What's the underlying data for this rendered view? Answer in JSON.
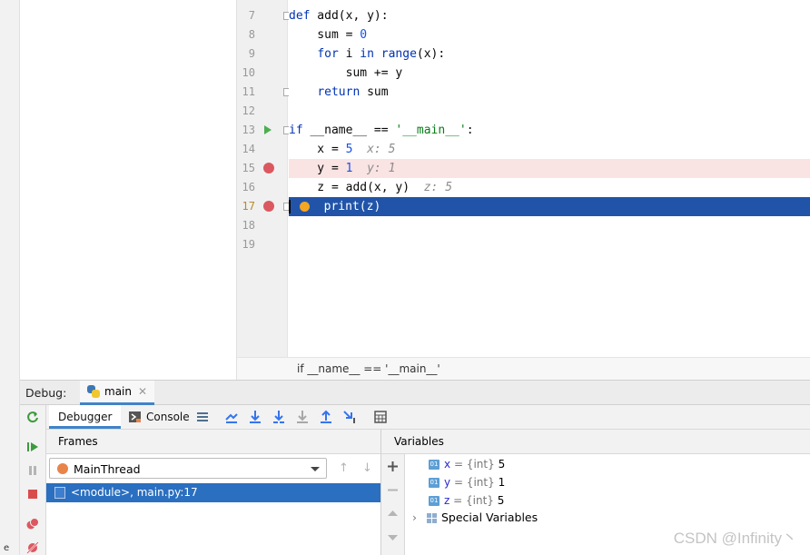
{
  "editor": {
    "lines": [
      {
        "num": "7"
      },
      {
        "num": "8"
      },
      {
        "num": "9"
      },
      {
        "num": "10"
      },
      {
        "num": "11"
      },
      {
        "num": "12"
      },
      {
        "num": "13"
      },
      {
        "num": "14"
      },
      {
        "num": "15"
      },
      {
        "num": "16"
      },
      {
        "num": "17"
      },
      {
        "num": "18"
      },
      {
        "num": "19"
      }
    ],
    "code": {
      "l7_kw": "def",
      "l7_rest": " add(x, y):",
      "l8_a": "    sum = ",
      "l8_num": "0",
      "l9_kw1": "for",
      "l9_a": " i ",
      "l9_kw2": "in",
      "l9_kw3": "range",
      "l9_rest": "(x):",
      "l10": "        sum += y",
      "l11_kw": "return",
      "l11_rest": " sum",
      "l13_kw": "if",
      "l13_a": " __name__ == ",
      "l13_str": "'__main__'",
      "l13_rest": ":",
      "l14_a": "    x = ",
      "l14_num": "5",
      "l14_hint": "x: 5",
      "l15_a": "    y = ",
      "l15_num": "1",
      "l15_hint": "y: 1",
      "l16_a": "    z = add(x, y)",
      "l16_hint": "z: 5",
      "l17": "print(z)"
    },
    "breadcrumb": "if __name__ == '__main__'"
  },
  "debug": {
    "label": "Debug:",
    "tab": "main",
    "tabs": {
      "debugger": "Debugger",
      "console": "Console"
    },
    "frames": {
      "title": "Frames",
      "thread": "MainThread",
      "selected_frame": "<module>, main.py:17"
    },
    "variables": {
      "title": "Variables",
      "items": [
        {
          "name": "x",
          "type": "= {int}",
          "value": "5"
        },
        {
          "name": "y",
          "type": "= {int}",
          "value": "1"
        },
        {
          "name": "z",
          "type": "= {int}",
          "value": "5"
        }
      ],
      "special": "Special Variables"
    }
  },
  "icons": {
    "var": "01"
  },
  "watermark": "CSDN @Infinity丶",
  "colors": {
    "exec_line": "#2154a8",
    "breakpoint": "#db5860",
    "breakpoint_line": "#fae3e3",
    "selection": "#2a6fc0"
  }
}
